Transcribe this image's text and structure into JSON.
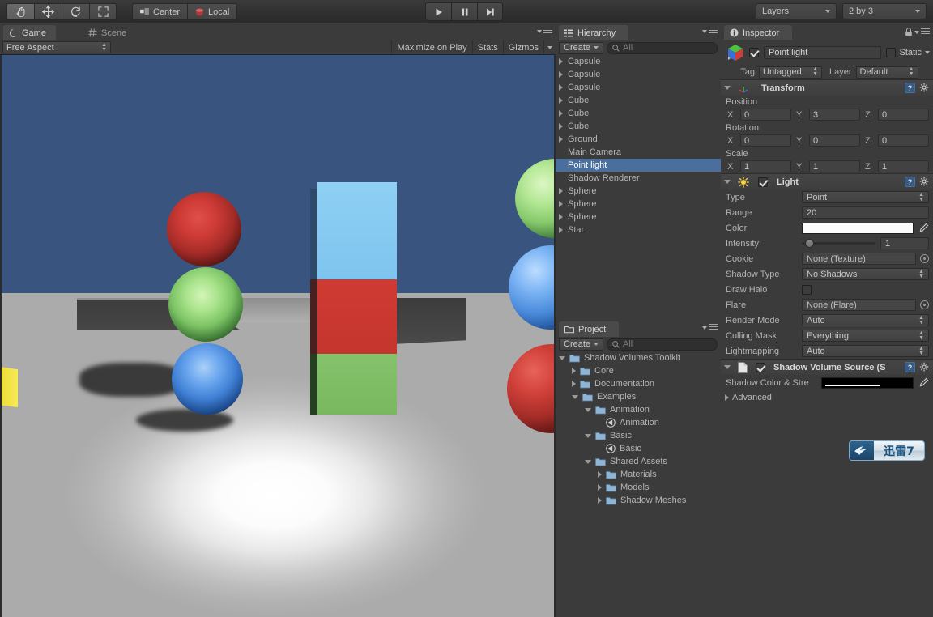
{
  "toolbar": {
    "tools": [
      {
        "name": "hand-tool",
        "icon": "hand-icon",
        "active": true
      },
      {
        "name": "move-tool",
        "icon": "move-icon",
        "active": false
      },
      {
        "name": "rotate-tool",
        "icon": "rotate-icon",
        "active": false
      },
      {
        "name": "scale-tool",
        "icon": "scale-icon",
        "active": false
      }
    ],
    "pivot_label": "Center",
    "space_label": "Local",
    "play_label": "play-icon",
    "pause_label": "pause-icon",
    "step_label": "step-icon",
    "layers_label": "Layers",
    "layout_label": "2 by 3"
  },
  "game_panel": {
    "tabs": [
      {
        "label": "Game",
        "active": true,
        "icon": "game-icon"
      },
      {
        "label": "Scene",
        "active": false,
        "icon": "scene-grid-icon"
      }
    ],
    "aspect": "Free Aspect",
    "maximize_on_play": "Maximize on Play",
    "stats": "Stats",
    "gizmos": "Gizmos"
  },
  "scene": {
    "sky_color": "#3a5480",
    "floor_color": "#b4b4b4",
    "objects": [
      {
        "name": "red-sphere",
        "color": "#c0332e"
      },
      {
        "name": "green-sphere",
        "color": "#86cc72"
      },
      {
        "name": "blue-sphere",
        "color": "#4f8fe0"
      },
      {
        "name": "cyan-cube",
        "color": "#87ccf0"
      },
      {
        "name": "red-cube",
        "color": "#cc3a33"
      },
      {
        "name": "green-cube",
        "color": "#7bbf63"
      },
      {
        "name": "yellow-cube",
        "color": "#f2e03a"
      }
    ]
  },
  "hierarchy": {
    "tab_label": "Hierarchy",
    "create_label": "Create",
    "search_placeholder": "All",
    "items": [
      {
        "label": "Capsule",
        "expandable": true,
        "selected": false
      },
      {
        "label": "Capsule",
        "expandable": true,
        "selected": false
      },
      {
        "label": "Capsule",
        "expandable": true,
        "selected": false
      },
      {
        "label": "Cube",
        "expandable": true,
        "selected": false
      },
      {
        "label": "Cube",
        "expandable": true,
        "selected": false
      },
      {
        "label": "Cube",
        "expandable": true,
        "selected": false
      },
      {
        "label": "Ground",
        "expandable": true,
        "selected": false
      },
      {
        "label": "Main Camera",
        "expandable": false,
        "selected": false
      },
      {
        "label": "Point light",
        "expandable": false,
        "selected": true
      },
      {
        "label": "Shadow Renderer",
        "expandable": false,
        "selected": false
      },
      {
        "label": "Sphere",
        "expandable": true,
        "selected": false
      },
      {
        "label": "Sphere",
        "expandable": true,
        "selected": false
      },
      {
        "label": "Sphere",
        "expandable": true,
        "selected": false
      },
      {
        "label": "Star",
        "expandable": true,
        "selected": false
      }
    ]
  },
  "project": {
    "tab_label": "Project",
    "create_label": "Create",
    "search_placeholder": "All",
    "items": [
      {
        "label": "Shadow Volumes Toolkit",
        "indent": 0,
        "state": "open",
        "icon": "folder"
      },
      {
        "label": "Core",
        "indent": 1,
        "state": "closed",
        "icon": "folder"
      },
      {
        "label": "Documentation",
        "indent": 1,
        "state": "closed",
        "icon": "folder"
      },
      {
        "label": "Examples",
        "indent": 1,
        "state": "open",
        "icon": "folder"
      },
      {
        "label": "Animation",
        "indent": 2,
        "state": "open",
        "icon": "folder"
      },
      {
        "label": "Animation",
        "indent": 3,
        "state": "leaf",
        "icon": "scene-asset"
      },
      {
        "label": "Basic",
        "indent": 2,
        "state": "open",
        "icon": "folder"
      },
      {
        "label": "Basic",
        "indent": 3,
        "state": "leaf",
        "icon": "scene-asset"
      },
      {
        "label": "Shared Assets",
        "indent": 2,
        "state": "open",
        "icon": "folder"
      },
      {
        "label": "Materials",
        "indent": 3,
        "state": "closed",
        "icon": "folder"
      },
      {
        "label": "Models",
        "indent": 3,
        "state": "closed",
        "icon": "folder"
      },
      {
        "label": "Shadow Meshes",
        "indent": 3,
        "state": "closed",
        "icon": "folder"
      }
    ]
  },
  "inspector": {
    "tab_label": "Inspector",
    "object_name": "Point light",
    "object_enabled": true,
    "static_label": "Static",
    "tag_label": "Tag",
    "tag_value": "Untagged",
    "layer_label": "Layer",
    "layer_value": "Default",
    "transform": {
      "title": "Transform",
      "position_label": "Position",
      "rotation_label": "Rotation",
      "scale_label": "Scale",
      "axes": [
        "X",
        "Y",
        "Z"
      ],
      "position": [
        "0",
        "3",
        "0"
      ],
      "rotation": [
        "0",
        "0",
        "0"
      ],
      "scale": [
        "1",
        "1",
        "1"
      ]
    },
    "light": {
      "title": "Light",
      "enabled": true,
      "rows": [
        {
          "label": "Type",
          "value": "Point",
          "kind": "select"
        },
        {
          "label": "Range",
          "value": "20",
          "kind": "text"
        },
        {
          "label": "Color",
          "value": "#fbfbfb",
          "kind": "color"
        },
        {
          "label": "Intensity",
          "value": "1",
          "kind": "slider"
        },
        {
          "label": "Cookie",
          "value": "None (Texture)",
          "kind": "object"
        },
        {
          "label": "Shadow Type",
          "value": "No Shadows",
          "kind": "select"
        },
        {
          "label": "Draw Halo",
          "value": "",
          "kind": "checkbox"
        },
        {
          "label": "Flare",
          "value": "None (Flare)",
          "kind": "object"
        },
        {
          "label": "Render Mode",
          "value": "Auto",
          "kind": "select"
        },
        {
          "label": "Culling Mask",
          "value": "Everything",
          "kind": "select"
        },
        {
          "label": "Lightmapping",
          "value": "Auto",
          "kind": "select"
        }
      ]
    },
    "shadow_volume": {
      "title": "Shadow Volume Source (S",
      "enabled": true,
      "color_label": "Shadow Color & Stre",
      "color_value": "#000000",
      "advanced_label": "Advanced"
    }
  },
  "watermark": {
    "text": "迅雷7",
    "icon": "thunder-bird-icon"
  }
}
